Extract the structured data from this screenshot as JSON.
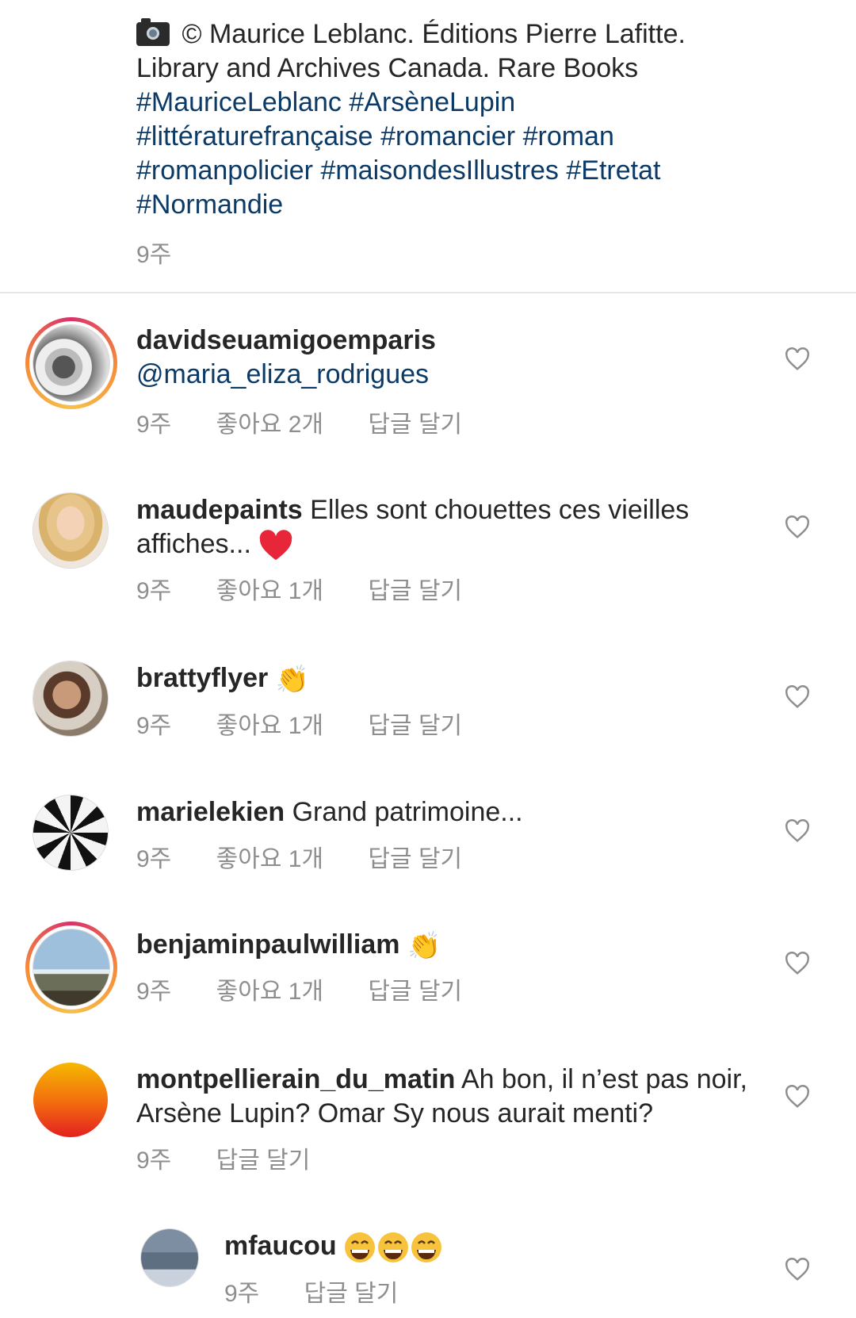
{
  "caption": {
    "text": "© Maurice Leblanc. Éditions Pierre Lafitte. Library and Archives Canada. Rare Books",
    "hashtags": [
      "#MauriceLeblanc",
      "#ArsèneLupin",
      "#littératurefrançaise",
      "#romancier",
      "#roman",
      "#romanpolicier",
      "#maisondesIllustres",
      "#Etretat",
      "#Normandie"
    ],
    "time": "9주",
    "icon": "camera-icon"
  },
  "comments": [
    {
      "user": "davidseuamigoemparis",
      "text": "",
      "mention": "@maria_eliza_rodrigues",
      "time": "9주",
      "likes": "좋아요 2개",
      "reply": "답글 달기"
    },
    {
      "user": "maudepaints",
      "text": "Elles sont chouettes ces vieilles affiches...",
      "emoji": "heart-emoji",
      "time": "9주",
      "likes": "좋아요 1개",
      "reply": "답글 달기"
    },
    {
      "user": "brattyflyer",
      "text": "",
      "emoji": "clapping-hands-emoji",
      "time": "9주",
      "likes": "좋아요 1개",
      "reply": "답글 달기"
    },
    {
      "user": "marielekien",
      "text": "Grand patrimoine...",
      "time": "9주",
      "likes": "좋아요 1개",
      "reply": "답글 달기"
    },
    {
      "user": "benjaminpaulwilliam",
      "text": "",
      "emoji": "clapping-hands-emoji",
      "time": "9주",
      "likes": "좋아요 1개",
      "reply": "답글 달기"
    },
    {
      "user": "montpellierain_du_matin",
      "text": "Ah bon, il n’est pas noir, Arsène Lupin? Omar Sy nous aurait menti?",
      "time": "9주",
      "reply": "답글 달기"
    },
    {
      "user": "mfaucou",
      "text": "",
      "emoji": "grinning-face-emoji x3",
      "time": "9주",
      "reply": "답글 달기"
    }
  ],
  "colors": {
    "link": "#0b3a66",
    "muted": "#8e8e8e",
    "text": "#262626",
    "heart_emoji": "#e8263a"
  }
}
